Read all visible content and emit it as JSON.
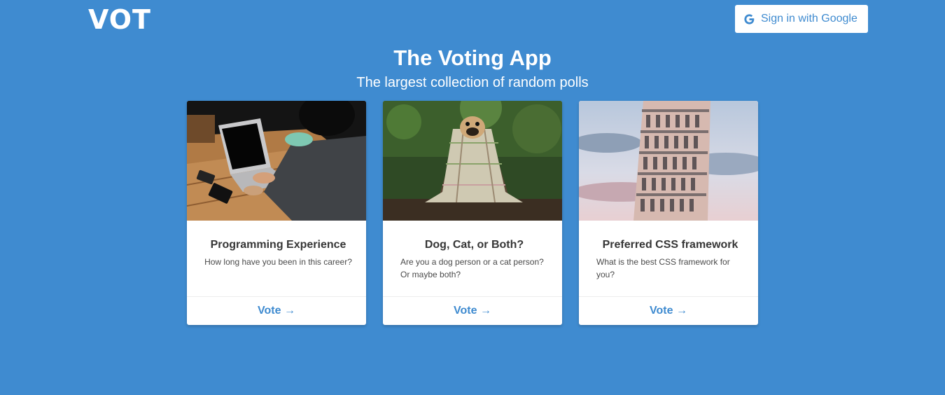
{
  "brand": {
    "logo": "VOT"
  },
  "auth": {
    "signin_label": "Sign in with Google",
    "icon": "google-icon"
  },
  "hero": {
    "title": "The Voting App",
    "subtitle": "The largest collection of random polls"
  },
  "polls": [
    {
      "title": "Programming Experience",
      "description": "How long have you been in this career?",
      "image": "laptop-photo",
      "cta": "Vote →"
    },
    {
      "title": "Dog, Cat, or Both?",
      "description": "Are you a dog person or a cat person? Or maybe both?",
      "image": "pug-in-blanket-photo",
      "cta": "Vote →"
    },
    {
      "title": "Preferred CSS framework",
      "description": "What is the best CSS framework for you?",
      "image": "leaning-tower-photo",
      "cta": "Vote →"
    }
  ],
  "colors": {
    "background": "#3f8bd0",
    "accent": "#3f8bd0",
    "card": "#ffffff"
  }
}
